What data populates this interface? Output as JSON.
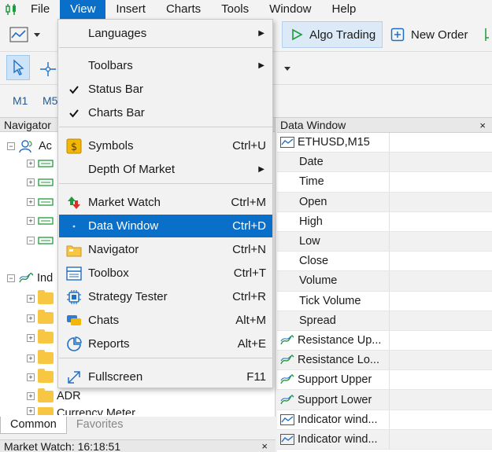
{
  "menubar": {
    "items": [
      {
        "label": "File"
      },
      {
        "label": "View",
        "active": true
      },
      {
        "label": "Insert"
      },
      {
        "label": "Charts"
      },
      {
        "label": "Tools"
      },
      {
        "label": "Window"
      },
      {
        "label": "Help"
      }
    ]
  },
  "toolbar": {
    "algo_trading": "Algo Trading",
    "new_order": "New Order",
    "timeframes": [
      "M1",
      "M5"
    ]
  },
  "view_menu": {
    "items": [
      {
        "label": "Languages",
        "shortcut": "",
        "submenu": true,
        "icon": ""
      },
      {
        "label": "Toolbars",
        "shortcut": "",
        "submenu": true,
        "icon": ""
      },
      {
        "label": "Status Bar",
        "shortcut": "",
        "submenu": false,
        "icon": "checkmark-icon"
      },
      {
        "label": "Charts Bar",
        "shortcut": "",
        "submenu": false,
        "icon": "checkmark-icon"
      },
      {
        "label": "Symbols",
        "shortcut": "Ctrl+U",
        "submenu": false,
        "icon": "symbols-icon"
      },
      {
        "label": "Depth Of Market",
        "shortcut": "",
        "submenu": true,
        "icon": ""
      },
      {
        "label": "Market Watch",
        "shortcut": "Ctrl+M",
        "submenu": false,
        "icon": "market-watch-icon"
      },
      {
        "label": "Data Window",
        "shortcut": "Ctrl+D",
        "submenu": false,
        "icon": "data-window-icon",
        "selected": true
      },
      {
        "label": "Navigator",
        "shortcut": "Ctrl+N",
        "submenu": false,
        "icon": "navigator-icon"
      },
      {
        "label": "Toolbox",
        "shortcut": "Ctrl+T",
        "submenu": false,
        "icon": "toolbox-icon"
      },
      {
        "label": "Strategy Tester",
        "shortcut": "Ctrl+R",
        "submenu": false,
        "icon": "strategy-tester-icon"
      },
      {
        "label": "Chats",
        "shortcut": "Alt+M",
        "submenu": false,
        "icon": "chats-icon"
      },
      {
        "label": "Reports",
        "shortcut": "Alt+E",
        "submenu": false,
        "icon": "reports-icon"
      },
      {
        "label": "Fullscreen",
        "shortcut": "F11",
        "submenu": false,
        "icon": "fullscreen-icon"
      }
    ]
  },
  "navigator": {
    "title": "Navigator",
    "accounts_label": "Ac",
    "indicators_label": "Ind",
    "adr_label": "ADR",
    "currency_meter_label": "Currency Meter",
    "tabs": [
      "Common",
      "Favorites"
    ]
  },
  "market_watch": {
    "title": "Market Watch: 16:18:51",
    "close": "×"
  },
  "data_window": {
    "title": "Data Window",
    "close": "×",
    "rows": [
      {
        "label": "ETHUSD,M15",
        "icon": "chart-line-icon"
      },
      {
        "label": "Date",
        "icon": ""
      },
      {
        "label": "Time",
        "icon": ""
      },
      {
        "label": "Open",
        "icon": ""
      },
      {
        "label": "High",
        "icon": ""
      },
      {
        "label": "Low",
        "icon": ""
      },
      {
        "label": "Close",
        "icon": ""
      },
      {
        "label": "Volume",
        "icon": ""
      },
      {
        "label": "Tick Volume",
        "icon": ""
      },
      {
        "label": "Spread",
        "icon": ""
      },
      {
        "label": "Resistance Up...",
        "icon": "indicator-icon"
      },
      {
        "label": "Resistance Lo...",
        "icon": "indicator-icon"
      },
      {
        "label": "Support Upper",
        "icon": "indicator-icon"
      },
      {
        "label": "Support Lower",
        "icon": "indicator-icon"
      },
      {
        "label": "Indicator wind...",
        "icon": "chart-line-icon"
      },
      {
        "label": "Indicator wind...",
        "icon": "chart-line-icon"
      }
    ]
  },
  "colors": {
    "accent": "#0a6fc8",
    "selection": "#cde3f7"
  }
}
